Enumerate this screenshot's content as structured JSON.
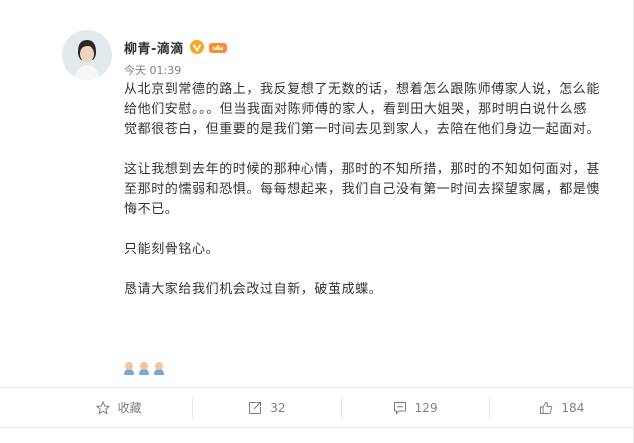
{
  "post": {
    "username": "柳青-滴滴",
    "verified_icon": "v-verified-icon",
    "badge_icon": "crown-badge-icon",
    "timestamp": "今天 01:39",
    "paragraphs": [
      "从北京到常德的路上，我反复想了无数的话，想着怎么跟陈师傅家人说，怎么能\n给他们安慰。。。但当我面对陈师傅的家人，看到田大姐哭，那时明白说什么感\n觉都很苍白，但重要的是我们第一时间去见到家人，去陪在他们身边一起面对。",
      "这让我想到去年的时候的那种心情，那时的不知所措，那时的不知如何面对，甚\n至那时的懦弱和恐惧。每每想起来，我们自己没有第一时间去探望家属，都是懊\n悔不已。",
      "只能刻骨铭心。",
      "恳请大家给我们机会改过自新，破茧成蝶。"
    ],
    "emojis": [
      "pray-emoji",
      "pray-emoji",
      "pray-emoji"
    ]
  },
  "actions": {
    "favorite_label": "收藏",
    "repost_count": "32",
    "comment_count": "129",
    "like_count": "184"
  }
}
